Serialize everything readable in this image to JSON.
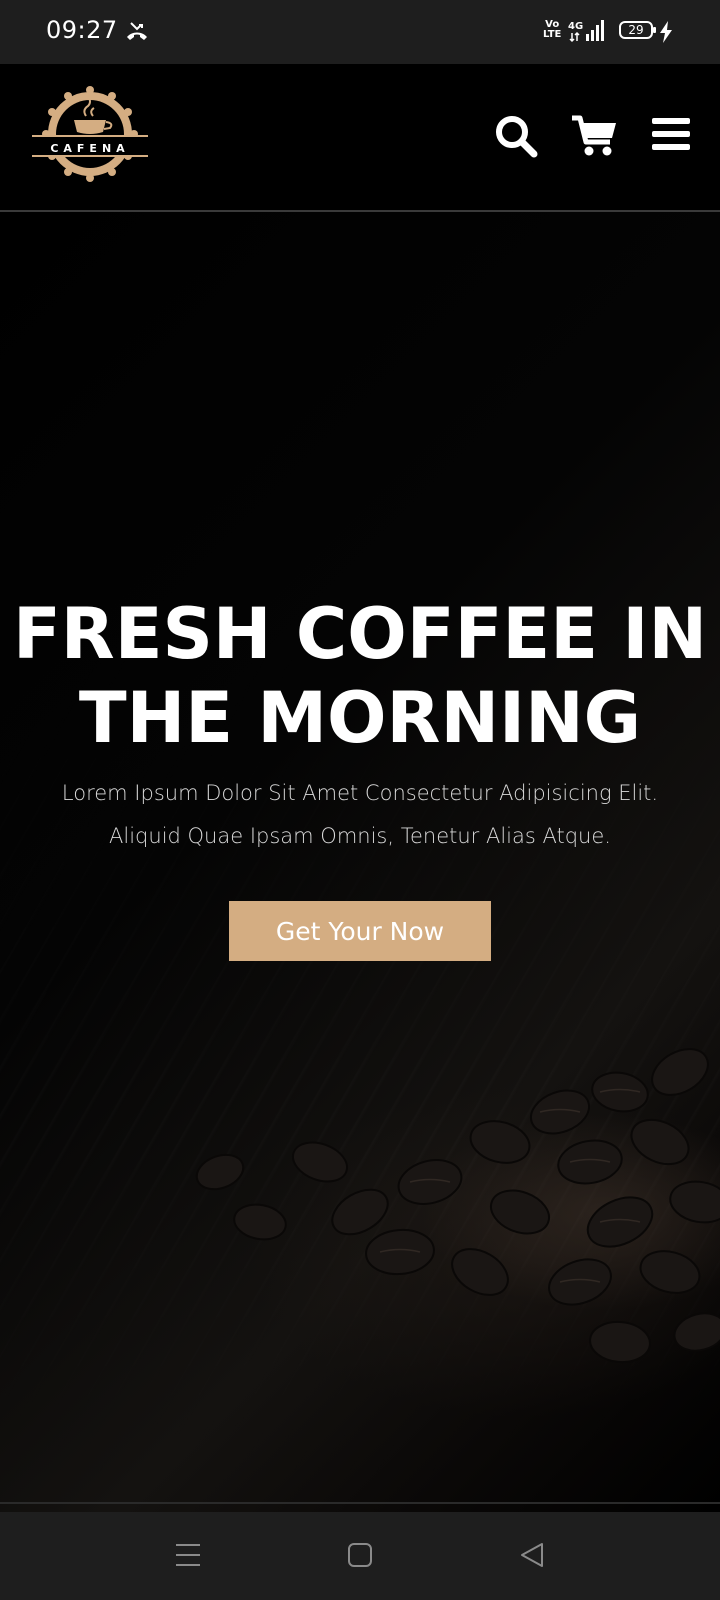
{
  "status_bar": {
    "time": "09:27",
    "volte_top": "Vo",
    "volte_bottom": "LTE",
    "network": "4G",
    "battery": "29"
  },
  "header": {
    "logo_text": "CAFENA",
    "icons": [
      "search-icon",
      "cart-icon",
      "menu-icon"
    ]
  },
  "hero": {
    "title_line1": "FRESH COFFEE IN",
    "title_line2": "THE MORNING",
    "subtitle_line1": "Lorem Ipsum Dolor Sit Amet Consectetur Adipisicing Elit.",
    "subtitle_line2": "Aliquid Quae Ipsam Omnis, Tenetur Alias Atque.",
    "cta_label": "Get Your Now"
  },
  "nav_bar": {
    "buttons": [
      "recents-icon",
      "home-icon",
      "back-icon"
    ]
  },
  "colors": {
    "accent": "#d4ad82",
    "background": "#000000",
    "system_bar": "#1e1e1e"
  }
}
